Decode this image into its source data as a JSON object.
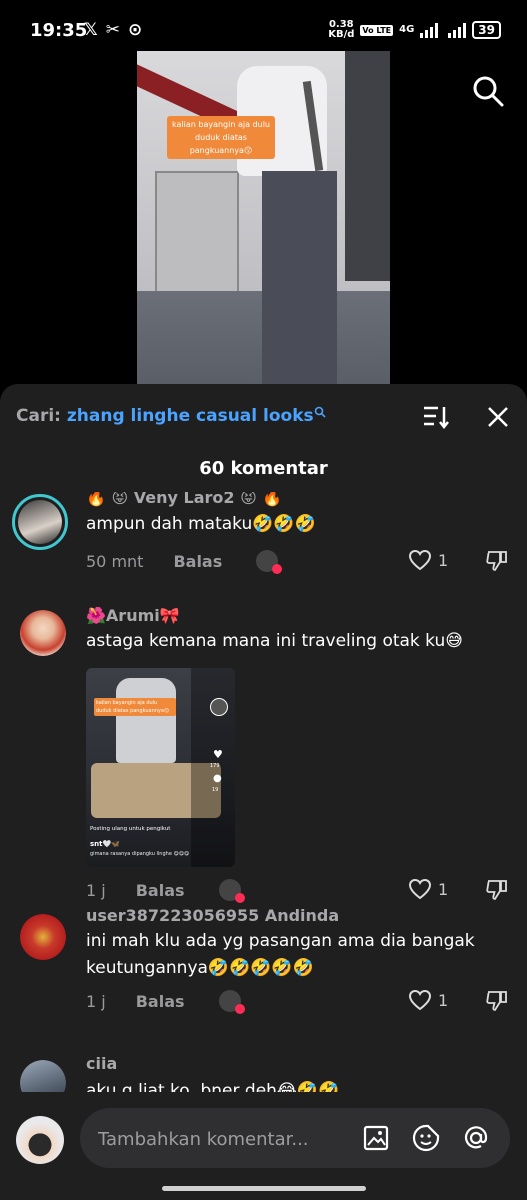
{
  "status_bar": {
    "time": "19:35",
    "speed_value": "0.38",
    "speed_unit": "KB/d",
    "volte": "Vo LTE",
    "network": "4G",
    "battery": "39"
  },
  "video": {
    "caption": "kalian bayangin aja dulu duduk diatas pangkuannya😗"
  },
  "sheet": {
    "search_label": "Cari:",
    "search_query": "zhang linghe casual looks",
    "comment_count": "60 komentar"
  },
  "comments": [
    {
      "username": "🔥 😝 Veny Laro2 😝 🔥",
      "text": "ampun dah mataku🤣🤣🤣",
      "time": "50 mnt",
      "reply": "Balas",
      "likes": "1"
    },
    {
      "username": "🌺Arumi🎀",
      "text": "astaga kemana mana ini traveling otak ku😅",
      "time": "1 j",
      "reply": "Balas",
      "likes": "1",
      "thumbnail": {
        "caption": "kalian bayangin aja dulu duduk diatas pangkuannya😗",
        "repost": "Posting ulang untuk pengikut",
        "user": "snt🤍🦋",
        "desc": "gimana rasanya dipangku linghe 😋😋😋",
        "stat1": "179",
        "stat2": "19"
      }
    },
    {
      "username": "user387223056955 Andinda",
      "text": "ini mah klu ada yg pasangan ama dia bangak keutungannya🤣🤣🤣🤣🤣",
      "time": "1 j",
      "reply": "Balas",
      "likes": "1"
    },
    {
      "username": "ciia",
      "text": "aku g liat ko, bner deh😂🤣🤣"
    }
  ],
  "input": {
    "placeholder": "Tambahkan komentar..."
  }
}
